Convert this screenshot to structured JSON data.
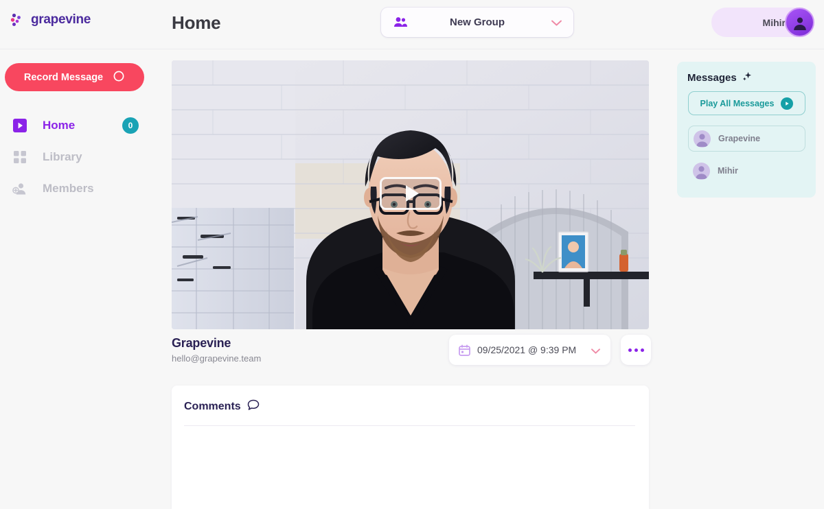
{
  "brand": {
    "name": "grapevine",
    "logo_icon": "grapevine-dots-logo",
    "colors": {
      "purple": "#8b23e8",
      "deep_purple": "#4b2a9e",
      "coral": "#f8475f",
      "teal": "#1aa3b5",
      "pink": "#ef7a9a",
      "navy": "#2a2154"
    }
  },
  "header": {
    "page_title": "Home",
    "group_select": {
      "label": "New Group",
      "left_icon": "people-icon",
      "right_icon": "chevron-down-icon"
    },
    "user": {
      "name": "Mihir",
      "avatar_icon": "user-avatar-icon"
    }
  },
  "sidebar": {
    "record_button": {
      "label": "Record Message",
      "icon": "record-circle-icon"
    },
    "items": [
      {
        "label": "Home",
        "icon": "play-square-icon",
        "active": true,
        "badge": "0"
      },
      {
        "label": "Library",
        "icon": "grid-squares-icon",
        "active": false,
        "badge": ""
      },
      {
        "label": "Members",
        "icon": "add-person-icon",
        "active": false,
        "badge": ""
      }
    ]
  },
  "main": {
    "video": {
      "play_icon": "play-triangle-icon",
      "alt": "Man with glasses in black v-neck shirt seated in front of white painted brick wall"
    },
    "meta": {
      "title": "Grapevine",
      "subtitle": "hello@grapevine.team",
      "date": "09/25/2021 @ 9:39 PM",
      "calendar_icon": "calendar-icon",
      "chevron_icon": "chevron-down-icon",
      "more_icon": "more-dots-icon"
    },
    "comments": {
      "title": "Comments",
      "icon": "speech-bubble-icon"
    }
  },
  "messages_panel": {
    "title": "Messages",
    "title_icon": "sparkle-icon",
    "play_all": {
      "label": "Play All Messages",
      "icon": "play-circle-icon"
    },
    "items": [
      {
        "name": "Grapevine",
        "avatar_icon": "user-avatar-icon",
        "selected": true
      },
      {
        "name": "Mihir",
        "avatar_icon": "user-avatar-icon",
        "selected": false
      }
    ]
  }
}
